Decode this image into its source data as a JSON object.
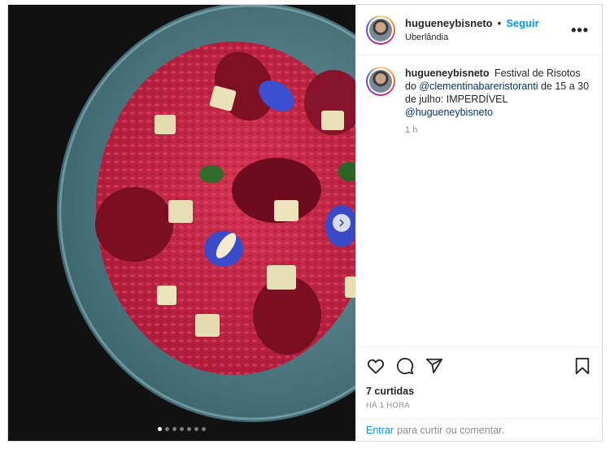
{
  "post": {
    "username": "hugueneybisneto",
    "separator": "•",
    "follow_label": "Seguir",
    "location": "Uberlândia",
    "more_label": "•••",
    "caption": {
      "username": "hugueneybisneto",
      "text_1": "Festival de Risotos do",
      "mention_1": "@clementinabareristoranti",
      "text_2": "de 15 a 30 de julho: IMPERDÍVEL",
      "mention_2": "@hugueneybisneto",
      "time": "1 h"
    },
    "likes": "7 curtidas",
    "posted_ago": "HÁ 1 HORA",
    "comment_bar": {
      "login_label": "Entrar",
      "text": "para curtir ou comentar."
    },
    "carousel": {
      "count": 7,
      "active": 0
    },
    "icons": [
      "heart-icon",
      "comment-icon",
      "share-icon",
      "bookmark-icon",
      "chevron-right-icon"
    ],
    "colors": {
      "accent": "#0095f6",
      "mention": "#00376b",
      "muted": "#8e8e8e"
    }
  }
}
